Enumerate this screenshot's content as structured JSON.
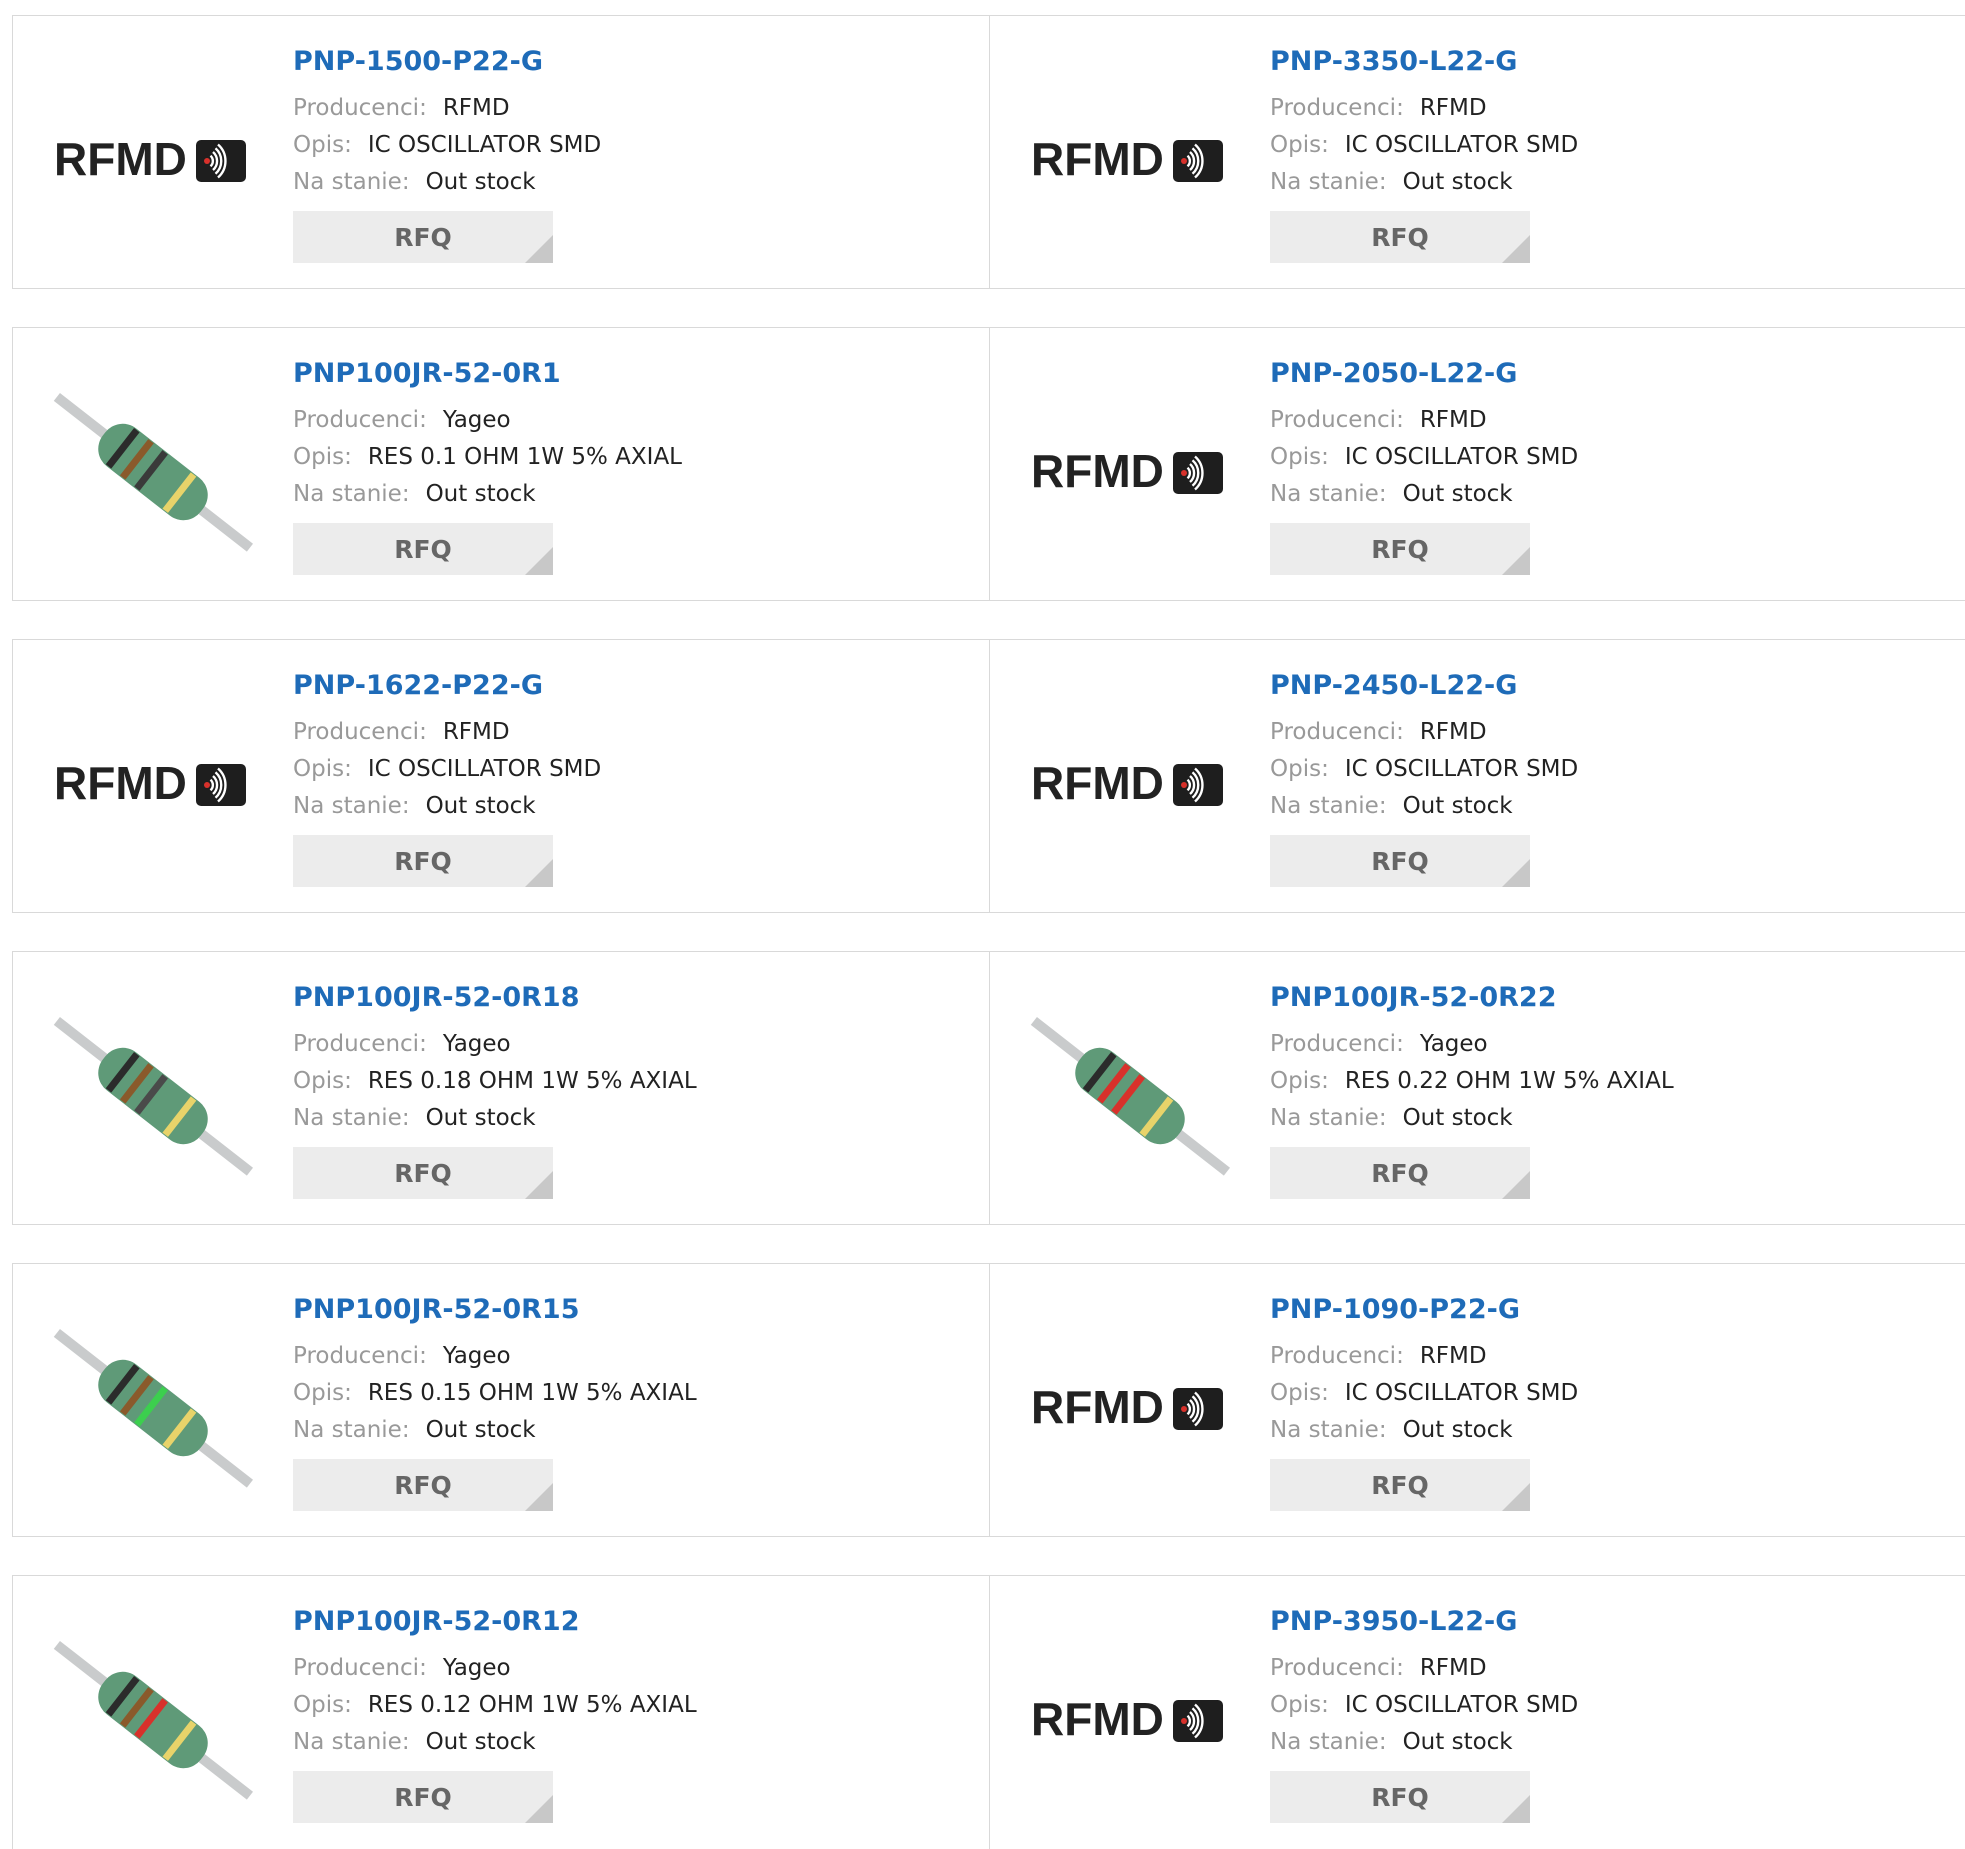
{
  "labels": {
    "manufacturer": "Producenci:",
    "description": "Opis:",
    "stock": "Na stanie:",
    "rfq": "RFQ"
  },
  "logo_text": "RFMD",
  "products": [
    {
      "part": "PNP-1500-P22-G",
      "manufacturer": "RFMD",
      "description": "IC OSCILLATOR SMD",
      "stock": "Out stock",
      "image": "rfmd-logo"
    },
    {
      "part": "PNP-3350-L22-G",
      "manufacturer": "RFMD",
      "description": "IC OSCILLATOR SMD",
      "stock": "Out stock",
      "image": "rfmd-logo"
    },
    {
      "part": "PNP100JR-52-0R1",
      "manufacturer": "Yageo",
      "description": "RES 0.1 OHM 1W 5% AXIAL",
      "stock": "Out stock",
      "image": "resistor",
      "bands": [
        "#2b2b2b",
        "#8a5a2b",
        "#3a3a3a",
        "#e8d36a"
      ]
    },
    {
      "part": "PNP-2050-L22-G",
      "manufacturer": "RFMD",
      "description": "IC OSCILLATOR SMD",
      "stock": "Out stock",
      "image": "rfmd-logo"
    },
    {
      "part": "PNP-1622-P22-G",
      "manufacturer": "RFMD",
      "description": "IC OSCILLATOR SMD",
      "stock": "Out stock",
      "image": "rfmd-logo"
    },
    {
      "part": "PNP-2450-L22-G",
      "manufacturer": "RFMD",
      "description": "IC OSCILLATOR SMD",
      "stock": "Out stock",
      "image": "rfmd-logo"
    },
    {
      "part": "PNP100JR-52-0R18",
      "manufacturer": "Yageo",
      "description": "RES 0.18 OHM 1W 5% AXIAL",
      "stock": "Out stock",
      "image": "resistor",
      "bands": [
        "#2b2b2b",
        "#8a5a2b",
        "#4a4a4a",
        "#e8d36a"
      ]
    },
    {
      "part": "PNP100JR-52-0R22",
      "manufacturer": "Yageo",
      "description": "RES 0.22 OHM 1W 5% AXIAL",
      "stock": "Out stock",
      "image": "resistor",
      "bands": [
        "#2b2b2b",
        "#d8312b",
        "#d8312b",
        "#e8d36a"
      ]
    },
    {
      "part": "PNP100JR-52-0R15",
      "manufacturer": "Yageo",
      "description": "RES 0.15 OHM 1W 5% AXIAL",
      "stock": "Out stock",
      "image": "resistor",
      "bands": [
        "#2b2b2b",
        "#8a5a2b",
        "#3ccf4e",
        "#e8d36a"
      ]
    },
    {
      "part": "PNP-1090-P22-G",
      "manufacturer": "RFMD",
      "description": "IC OSCILLATOR SMD",
      "stock": "Out stock",
      "image": "rfmd-logo"
    },
    {
      "part": "PNP100JR-52-0R12",
      "manufacturer": "Yageo",
      "description": "RES 0.12 OHM 1W 5% AXIAL",
      "stock": "Out stock",
      "image": "resistor",
      "bands": [
        "#2b2b2b",
        "#8a5a2b",
        "#d8312b",
        "#e8d36a"
      ]
    },
    {
      "part": "PNP-3950-L22-G",
      "manufacturer": "RFMD",
      "description": "IC OSCILLATOR SMD",
      "stock": "Out stock",
      "image": "rfmd-logo"
    }
  ]
}
